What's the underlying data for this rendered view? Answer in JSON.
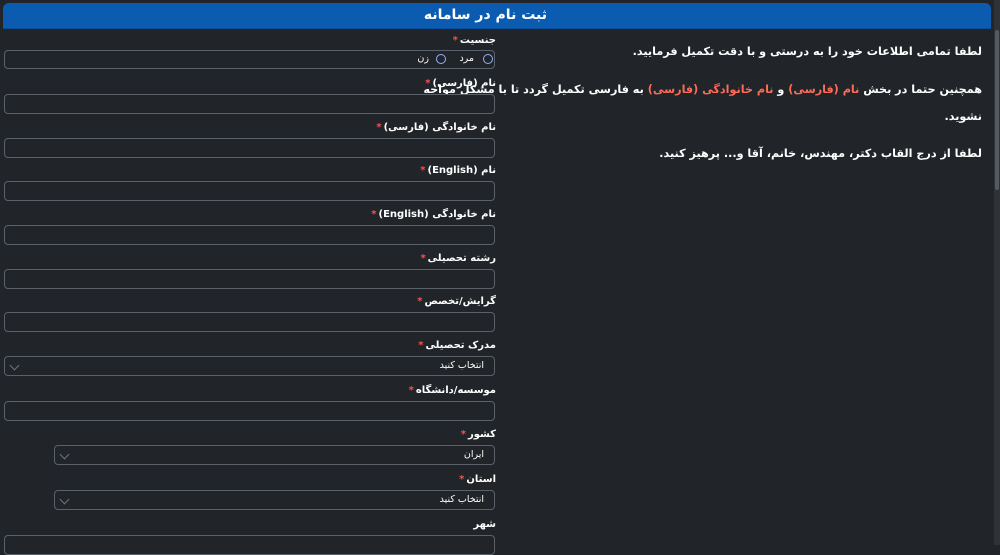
{
  "header": {
    "title": "ثبت نام در سامانه"
  },
  "info": {
    "line1": "لطفا تمامی اطلاعات خود را به درستی و با دقت تکمیل فرمایید.",
    "line2_prefix": "همچنین حتما در بخش",
    "line2_first_name": "نام (فارسی)",
    "line2_and": "و",
    "line2_last_name": "نام خانوادگی (فارسی)",
    "line2_suffix": "به فارسی تکمیل گردد تا با مشکل مواجه",
    "line3": "نشوید.",
    "line4": "لطفا از درج القاب دکتر، مهندس، خانم، آقا و... پرهیز کنید."
  },
  "form": {
    "required_marker": "*",
    "gender": {
      "label": "جنسیت",
      "options": [
        "مرد",
        "زن"
      ]
    },
    "first_name_fa": {
      "label": "نام (فارسی)",
      "value": ""
    },
    "last_name_fa": {
      "label": "نام خانوادگی (فارسی)",
      "value": ""
    },
    "first_name_en": {
      "label": "نام (English)",
      "value": ""
    },
    "last_name_en": {
      "label": "نام خانوادگی (English)",
      "value": ""
    },
    "field_of_study": {
      "label": "رشته تحصیلی",
      "value": ""
    },
    "specialty": {
      "label": "گرایش/تخصص",
      "value": ""
    },
    "degree": {
      "label": "مدرک تحصیلی",
      "selected": "انتخاب کنید"
    },
    "institute": {
      "label": "موسسه/دانشگاه",
      "value": ""
    },
    "country": {
      "label": "کشور",
      "selected": "ایران"
    },
    "province": {
      "label": "استان",
      "selected": "انتخاب کنید"
    },
    "city": {
      "label": "شهر",
      "value": ""
    }
  }
}
